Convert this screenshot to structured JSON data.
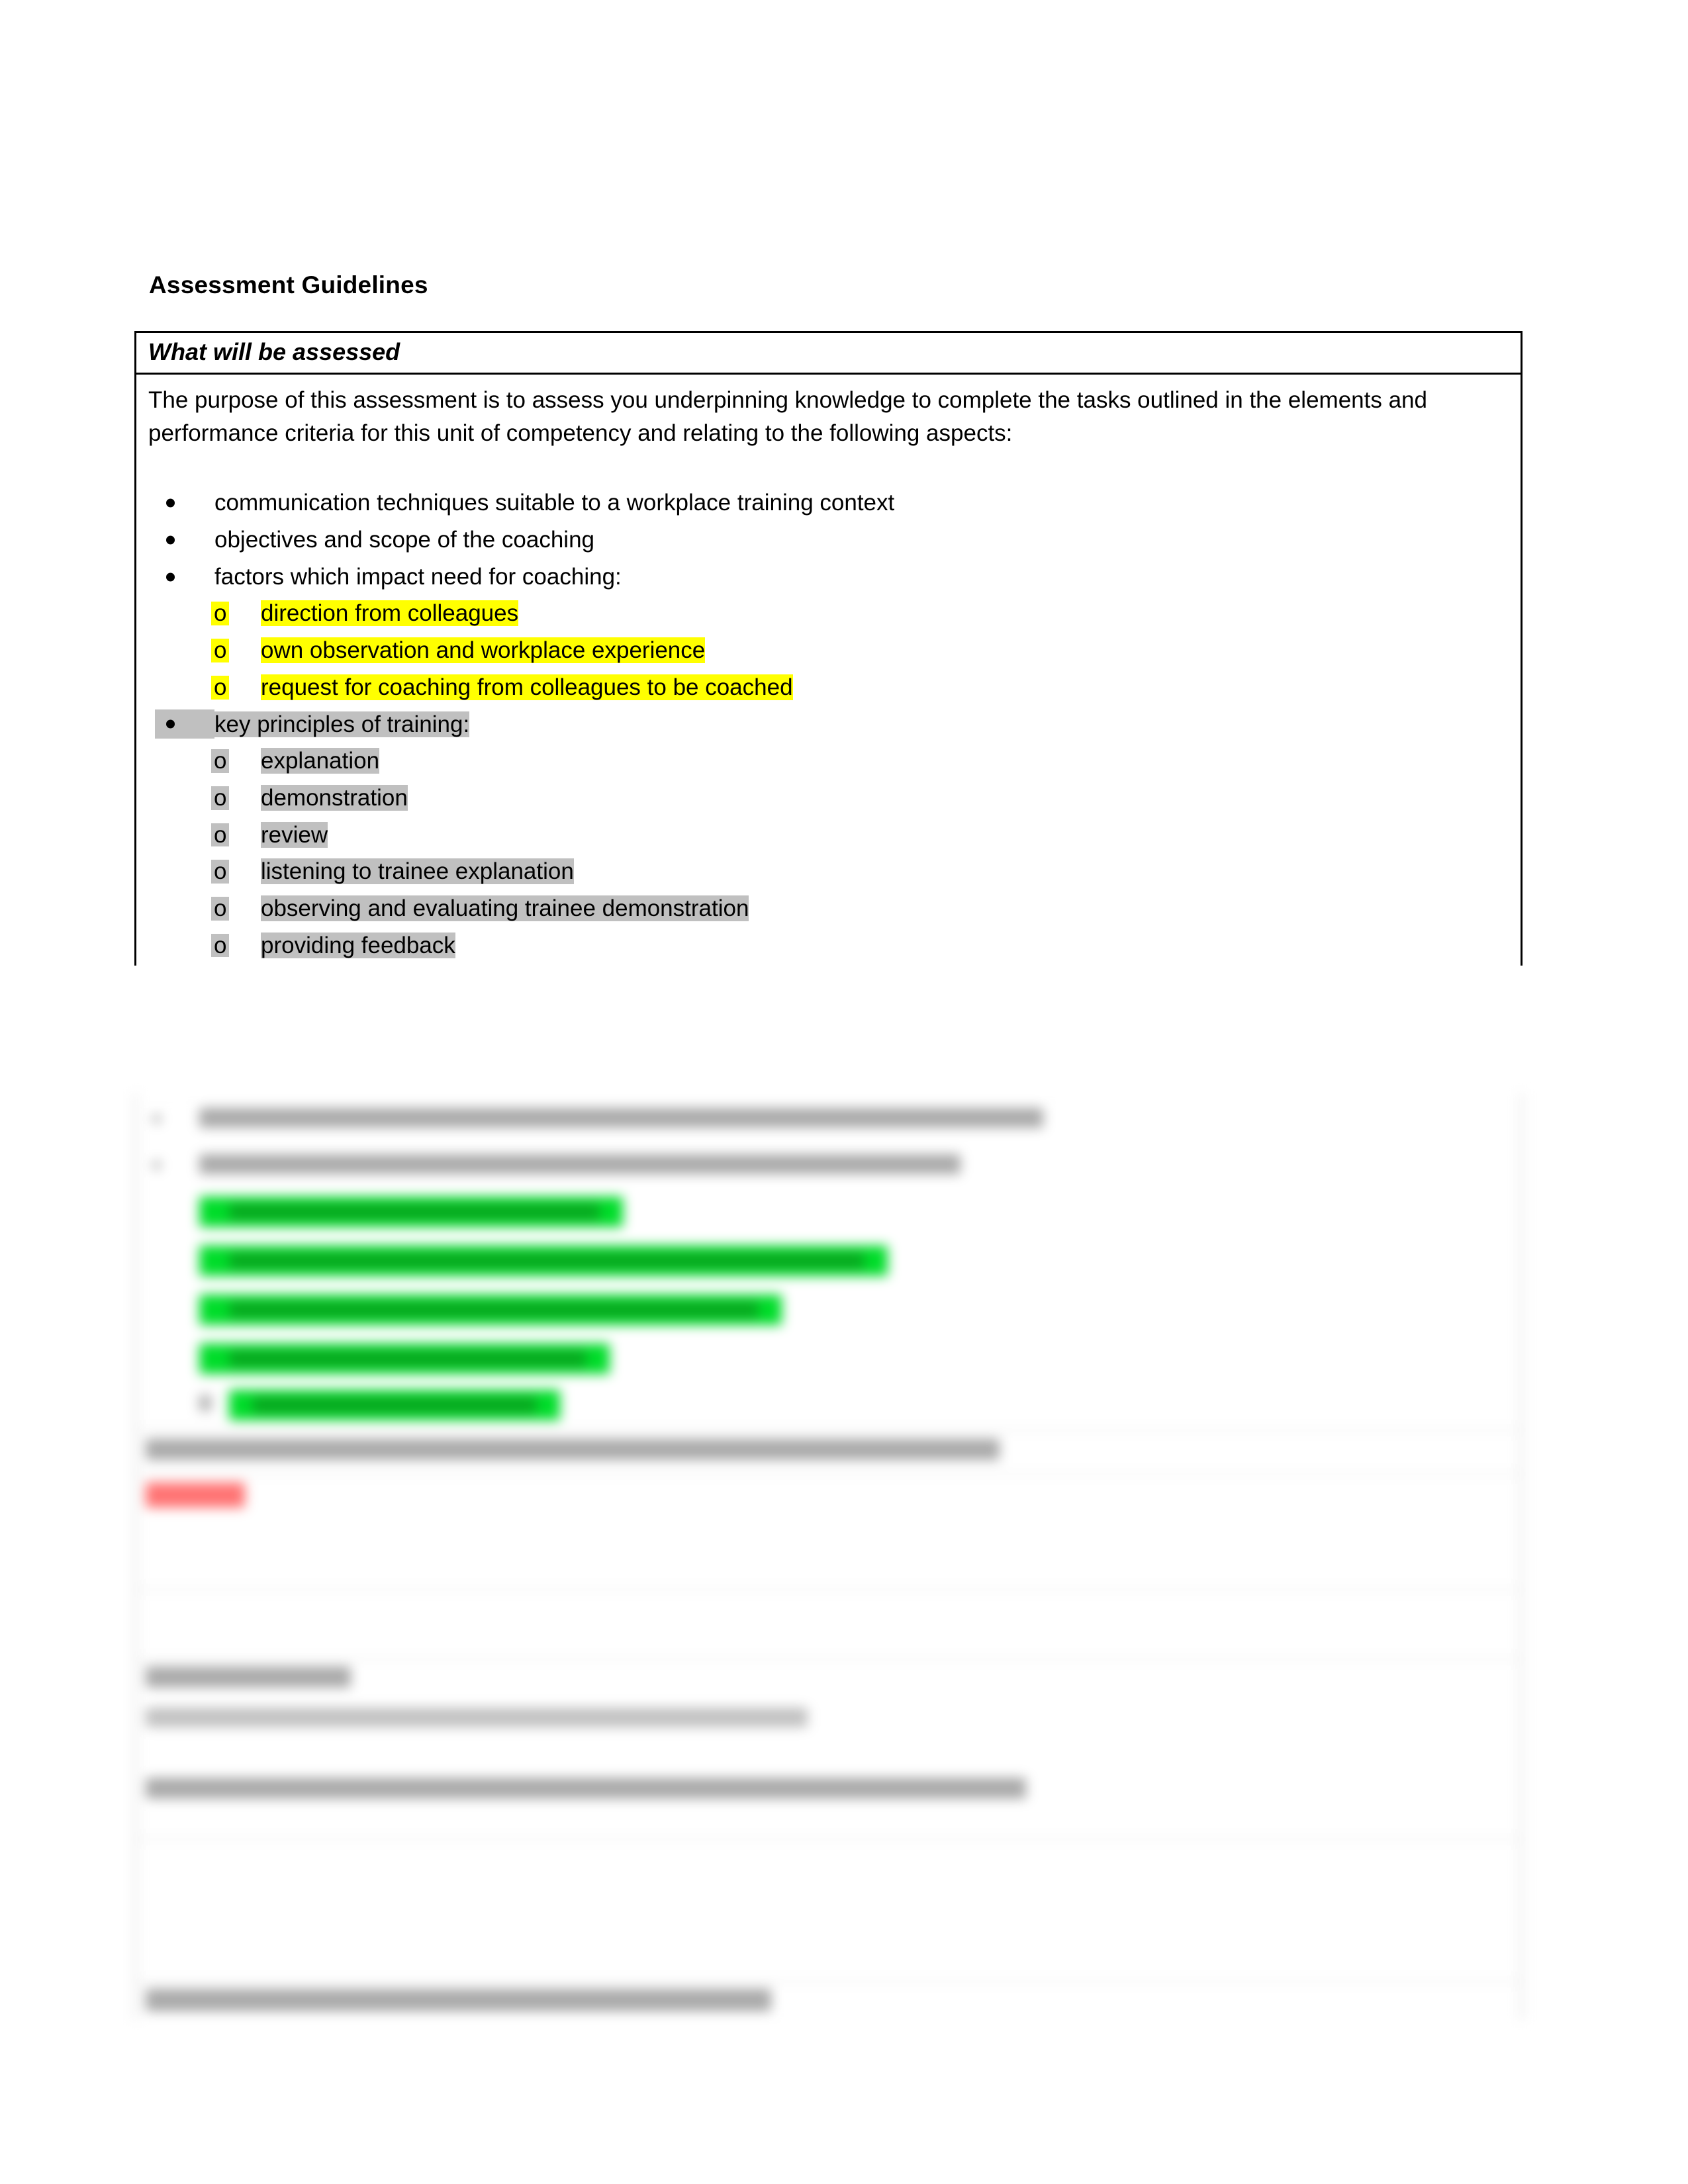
{
  "document": {
    "title": "Assessment Guidelines",
    "table": {
      "header": "What will be assessed",
      "intro": "The purpose of this assessment is to assess you underpinning knowledge to complete the tasks outlined in the elements and performance criteria for this unit of competency and relating to the following aspects:",
      "bullets": [
        {
          "text": "communication techniques suitable to a workplace training context",
          "highlight": "none",
          "subitems": []
        },
        {
          "text": "objectives and scope of the coaching",
          "highlight": "none",
          "subitems": []
        },
        {
          "text": "factors which impact need for coaching:",
          "highlight": "none",
          "subitems": [
            {
              "marker": "o",
              "text": "direction from colleagues",
              "highlight": "yellow"
            },
            {
              "marker": "o",
              "text": "own observation and workplace experience",
              "highlight": "yellow"
            },
            {
              "marker": "o",
              "text": "request for coaching from colleagues to be coached",
              "highlight": "yellow"
            }
          ]
        },
        {
          "text": "key principles of training:",
          "highlight": "gray",
          "subitems": [
            {
              "marker": "o",
              "text": "explanation",
              "highlight": "gray"
            },
            {
              "marker": "o",
              "text": "demonstration",
              "highlight": "gray"
            },
            {
              "marker": "o",
              "text": "review",
              "highlight": "gray"
            },
            {
              "marker": "o",
              "text": "listening to trainee explanation",
              "highlight": "gray"
            },
            {
              "marker": "o",
              "text": "observing and evaluating trainee demonstration",
              "highlight": "gray"
            },
            {
              "marker": "o",
              "text": "providing feedback",
              "highlight": "gray"
            }
          ]
        }
      ]
    }
  },
  "obscured_region": {
    "note": "Lower portion of the page is blurred beyond legibility; text content cannot be read from the pixels.",
    "colors": {
      "green_highlight": "#00dd2a",
      "red_highlight": "#ff6b6b",
      "gray_text": "#9b9b9b",
      "row_separator": "#e2e2e2"
    }
  },
  "palette": {
    "yellow_highlight": "#ffff00",
    "gray_highlight": "#c0c0c0",
    "text": "#000000",
    "border": "#000000",
    "page_background": "#ffffff"
  }
}
